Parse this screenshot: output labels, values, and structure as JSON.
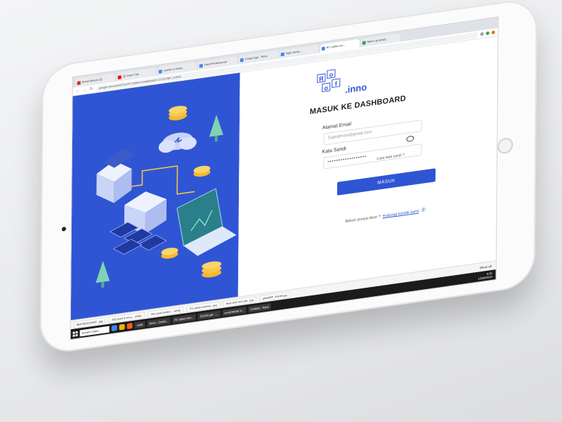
{
  "browser": {
    "tabs": [
      {
        "label": "Email Masuk (3)",
        "color": "#d93025"
      },
      {
        "label": "(1) Iwan Fals",
        "color": "#ff0000"
      },
      {
        "label": "contoh ui mate...",
        "color": "#4285f4"
      },
      {
        "label": "Hasil Penelusuran",
        "color": "#4285f4"
      },
      {
        "label": "Cmap logo - Penc",
        "color": "#4285f4"
      },
      {
        "label": "login wowo...",
        "color": "#4285f4"
      },
      {
        "label": "PC tablet mo...",
        "color": "#4285f4",
        "active": true
      },
      {
        "label": "Mock up templ...",
        "color": "#34a853"
      }
    ],
    "url": "google.com/search?q=PC+tablet+template&rlz=1C1CHBF_enID8..."
  },
  "login": {
    "logo_letters": [
      "R",
      "o",
      "o",
      "f"
    ],
    "logo_suffix": ".inno",
    "heading": "MASUK KE DASHBOARD",
    "email_label": "Alamat Email",
    "email_value": "Supratman@gmail.com",
    "password_label": "Kata Sandi",
    "password_value": "••••••••••••••••••",
    "forgot_label": "Lupa kata sandi ?",
    "submit_label": "MASUK",
    "signup_text": "Belum punya akun ?",
    "signup_link": "Hubungi kontak kami"
  },
  "downloads": {
    "items": [
      "86429810cbb49...jpg",
      "002-ipad-3-air-g....webp",
      "001-ipad-landsc....webp",
      "PC-tablet-antimo...jpg",
      "blue-and-red-can...jpg",
      "pbkBI9P_40x40.jpg"
    ],
    "show_all": "Show all"
  },
  "taskbar": {
    "search_placeholder": "Konten Video",
    "apps": [
      "LINE",
      "Work - OneN...",
      "PC tablet tem...",
      "ZOOM.pdf - ...",
      "coreIDRAW X...",
      "Untitled - Paint"
    ],
    "time": "6:35",
    "date": "12/06/2019"
  },
  "colors": {
    "brand_blue": "#2f55d4"
  }
}
